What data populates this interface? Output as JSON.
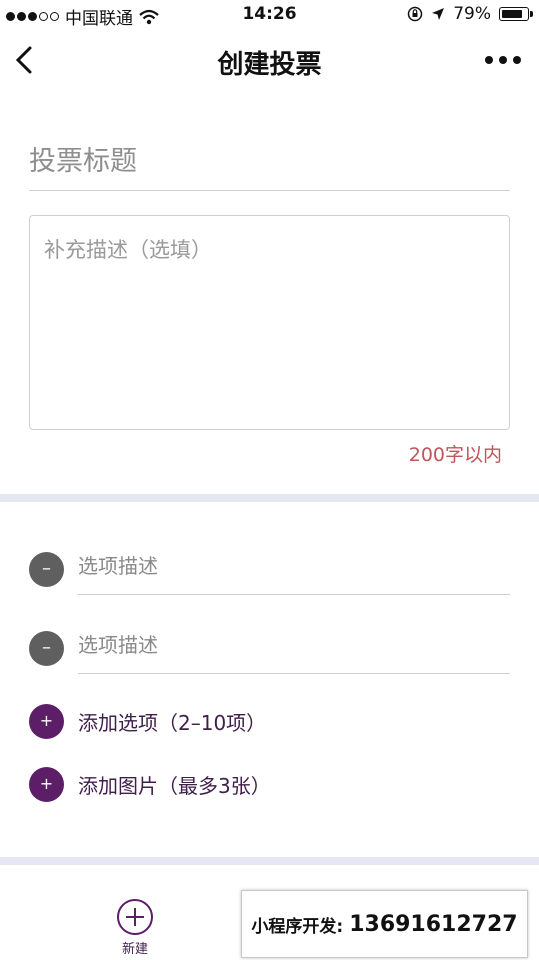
{
  "status_bar": {
    "carrier": "中国联通",
    "time": "14:26",
    "battery_percent": "79%",
    "battery_level": 0.79,
    "signal_dots_filled": 3,
    "signal_dots_total": 5,
    "icons": [
      "signal-dots-icon",
      "wifi-icon",
      "orientation-lock-icon",
      "location-arrow-icon",
      "battery-icon"
    ]
  },
  "nav": {
    "title": "创建投票",
    "back_icon": "chevron-left-icon",
    "more_icon": "more-dots-icon"
  },
  "form": {
    "title_placeholder": "投票标题",
    "description_placeholder": "补充描述（选填）",
    "char_limit": "200字以内",
    "char_limit_color": "#c0555a"
  },
  "options": {
    "items": [
      {
        "placeholder": "选项描述",
        "remove_label": "–"
      },
      {
        "placeholder": "选项描述",
        "remove_label": "–"
      }
    ],
    "add_option_label": "添加选项（2–10项）",
    "add_image_label": "添加图片（最多3张）",
    "add_icon_label": "+"
  },
  "tab_bar": {
    "new_label": "新建"
  },
  "overlay": {
    "label": "小程序开发:",
    "phone": "13691612727"
  },
  "colors": {
    "accent": "#5b1e67",
    "divider": "#e5e8f3",
    "remove_button": "#5f5f5f"
  }
}
